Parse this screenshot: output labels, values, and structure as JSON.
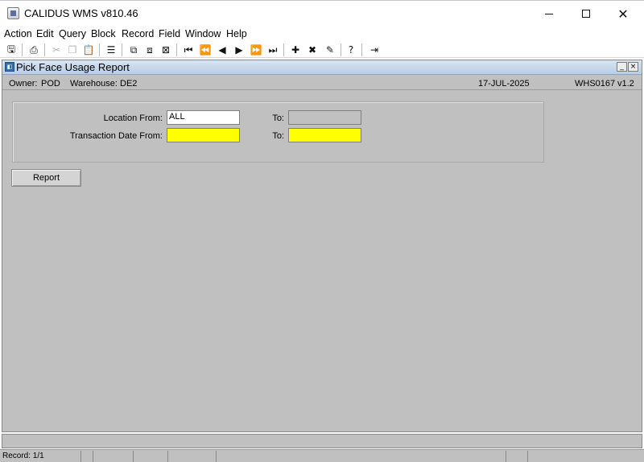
{
  "window": {
    "title": "CALIDUS WMS v810.46",
    "min_label": "—",
    "close_label": "✕"
  },
  "menu": [
    {
      "label": "Action"
    },
    {
      "label": "Edit"
    },
    {
      "label": "Query"
    },
    {
      "label": "Block"
    },
    {
      "label": "Record"
    },
    {
      "label": "Field"
    },
    {
      "label": "Window"
    },
    {
      "label": "Help"
    }
  ],
  "toolbar": {
    "icons": [
      "save-icon",
      "print-icon",
      "cut-icon",
      "copy-icon",
      "paste-icon",
      "list-icon",
      "enter-query-icon",
      "execute-query-icon",
      "cancel-query-icon",
      "first-record-icon",
      "previous-block-icon",
      "previous-record-icon",
      "next-record-icon",
      "next-block-icon",
      "last-record-icon",
      "insert-record-icon",
      "delete-record-icon",
      "clear-icon",
      "help-icon",
      "exit-icon"
    ],
    "glyphs": {
      "save": "🖫",
      "print": "⎙",
      "cut": "✂",
      "copy": "❐",
      "paste": "📋",
      "list": "☰",
      "enter_query": "⧉",
      "execute_query": "⧈",
      "cancel_query": "⊠",
      "first": "⏮",
      "prev_block": "⏪",
      "prev": "◀",
      "next": "▶",
      "next_block": "⏩",
      "last": "⏭",
      "insert": "✚",
      "delete": "✖",
      "clear": "✎",
      "help": "?",
      "exit": "⇥"
    }
  },
  "form": {
    "title": "Pick Face Usage Report",
    "icon_glyph": "◧",
    "min_label": "_",
    "close_label": "×",
    "owner_label": "Owner:",
    "owner_value": "POD",
    "warehouse_label": "Warehouse:",
    "warehouse_value": "DE2",
    "date": "17-JUL-2025",
    "module": "WHS0167",
    "version": "v1.2",
    "location_from_label": "Location From:",
    "location_from_value": "ALL",
    "location_to_label": "To:",
    "location_to_value": "",
    "txn_date_from_label": "Transaction Date From:",
    "txn_date_from_value": "",
    "txn_date_to_label": "To:",
    "txn_date_to_value": "",
    "report_button": "Report"
  },
  "status": {
    "record": "Record: 1/1"
  }
}
